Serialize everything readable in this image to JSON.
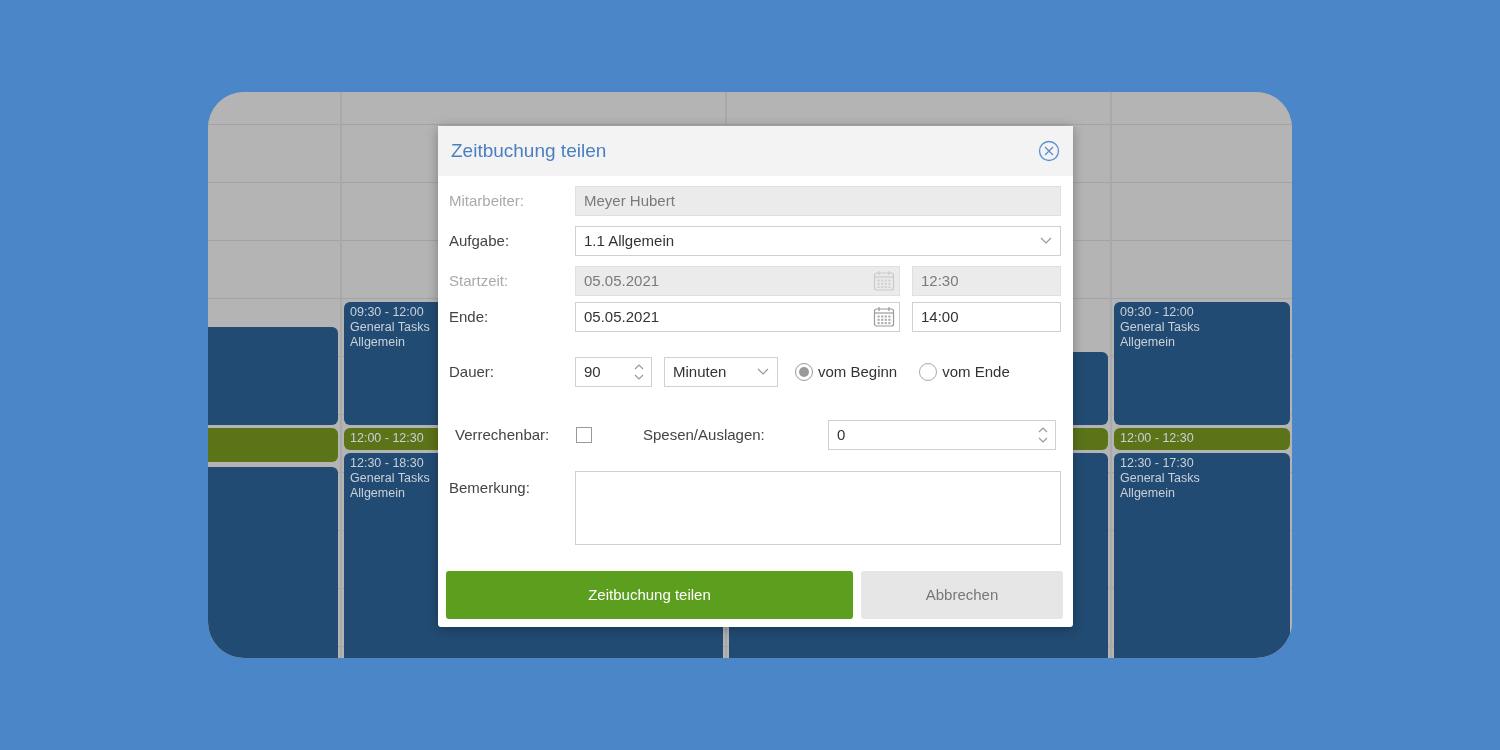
{
  "calendar": {
    "columns": [
      {
        "events": [
          {
            "kind": "work"
          },
          {
            "kind": "break"
          },
          {
            "kind": "work"
          }
        ]
      },
      {
        "events": [
          {
            "kind": "work",
            "time": "09:30 - 12:00",
            "task": "General Tasks",
            "category": "Allgemein"
          },
          {
            "kind": "break",
            "time": "12:00 - 12:30"
          },
          {
            "kind": "work",
            "time": "12:30 - 18:30",
            "task": "General Tasks",
            "category": "Allgemein"
          }
        ]
      },
      {
        "events": [
          {
            "kind": "work"
          },
          {
            "kind": "break"
          },
          {
            "kind": "work"
          }
        ]
      },
      {
        "events": [
          {
            "kind": "work",
            "time": "09:30 - 12:00",
            "task": "General Tasks",
            "category": "Allgemein"
          },
          {
            "kind": "break",
            "time": "12:00 - 12:30"
          },
          {
            "kind": "work",
            "time": "12:30 - 17:30",
            "task": "General Tasks",
            "category": "Allgemein"
          }
        ]
      }
    ]
  },
  "dialog": {
    "title": "Zeitbuchung teilen",
    "employee": {
      "label": "Mitarbeiter:",
      "value": "Meyer Hubert",
      "disabled": true
    },
    "task": {
      "label": "Aufgabe:",
      "value": "1.1 Allgemein"
    },
    "start": {
      "label": "Startzeit:",
      "date": "05.05.2021",
      "time": "12:30",
      "disabled": true
    },
    "end": {
      "label": "Ende:",
      "date": "05.05.2021",
      "time": "14:00",
      "disabled": false
    },
    "duration": {
      "label": "Dauer:",
      "value": "90",
      "unit": "Minuten",
      "options": [
        {
          "label": "vom Beginn",
          "selected": true
        },
        {
          "label": "vom Ende",
          "selected": false
        }
      ]
    },
    "billable": {
      "label": "Verrechenbar:",
      "checked": false
    },
    "expenses": {
      "label": "Spesen/Auslagen:",
      "value": "0"
    },
    "remark": {
      "label": "Bemerkung:"
    },
    "buttons": [
      {
        "label": "Zeitbuchung teilen",
        "kind": "primary"
      },
      {
        "label": "Abbrechen",
        "kind": "secondary"
      }
    ]
  }
}
